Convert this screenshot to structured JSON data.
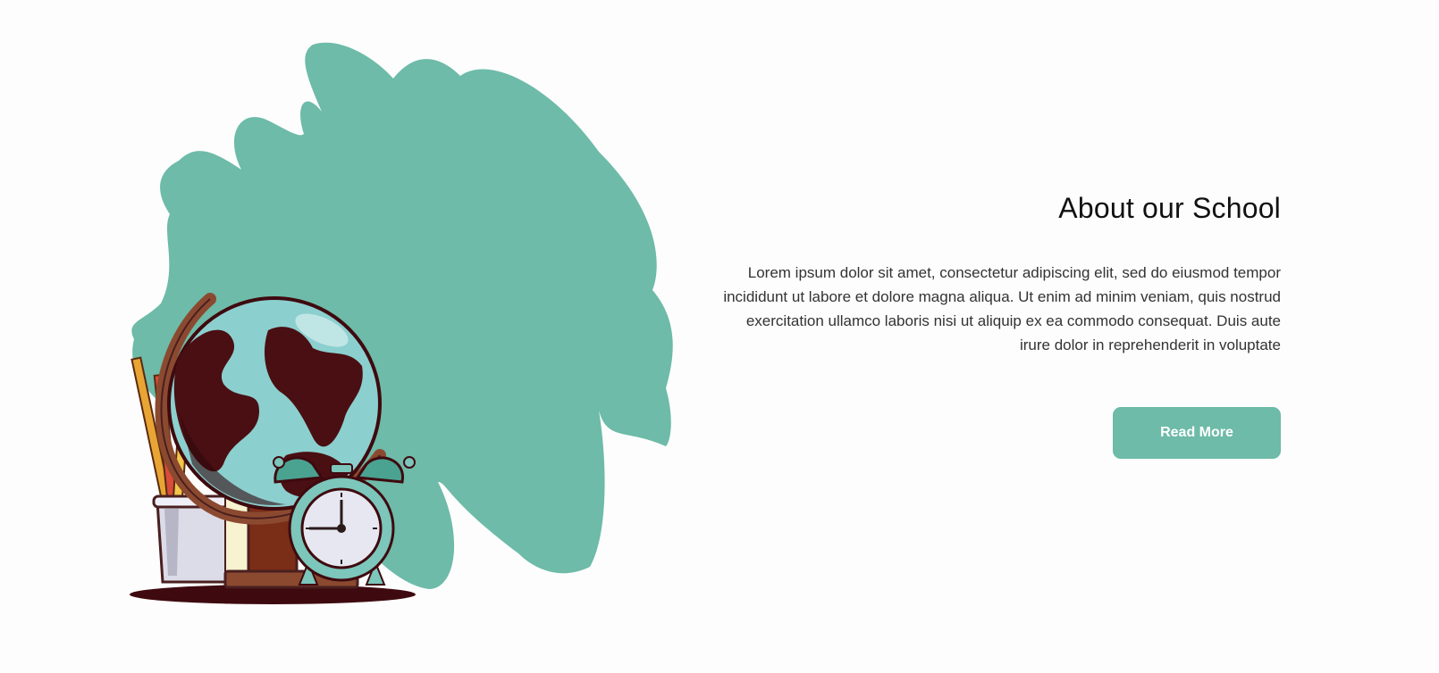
{
  "about": {
    "title": "About our School",
    "text": "Lorem ipsum dolor sit amet, consectetur adipiscing elit, sed do eiusmod tempor incididunt ut labore et dolore magna aliqua. Ut enim ad minim veniam, quis nostrud exercitation ullamco laboris nisi ut aliquip ex ea commodo consequat. Duis aute irure dolor in reprehenderit in voluptate",
    "button_label": "Read More"
  },
  "illustration": {
    "icon": "school-globe-clock-illustration",
    "colors": {
      "blob": "#6dbba8",
      "globe_ocean": "#8ccfcf",
      "globe_land": "#4a0f12",
      "stand": "#8b4a30",
      "clock": "#7cc6bb",
      "shadow": "#3e0a0f"
    }
  },
  "theme": {
    "accent": "#6dbba8",
    "title_color": "#111111",
    "text_color": "#333333",
    "background": "#fdfdfd"
  }
}
